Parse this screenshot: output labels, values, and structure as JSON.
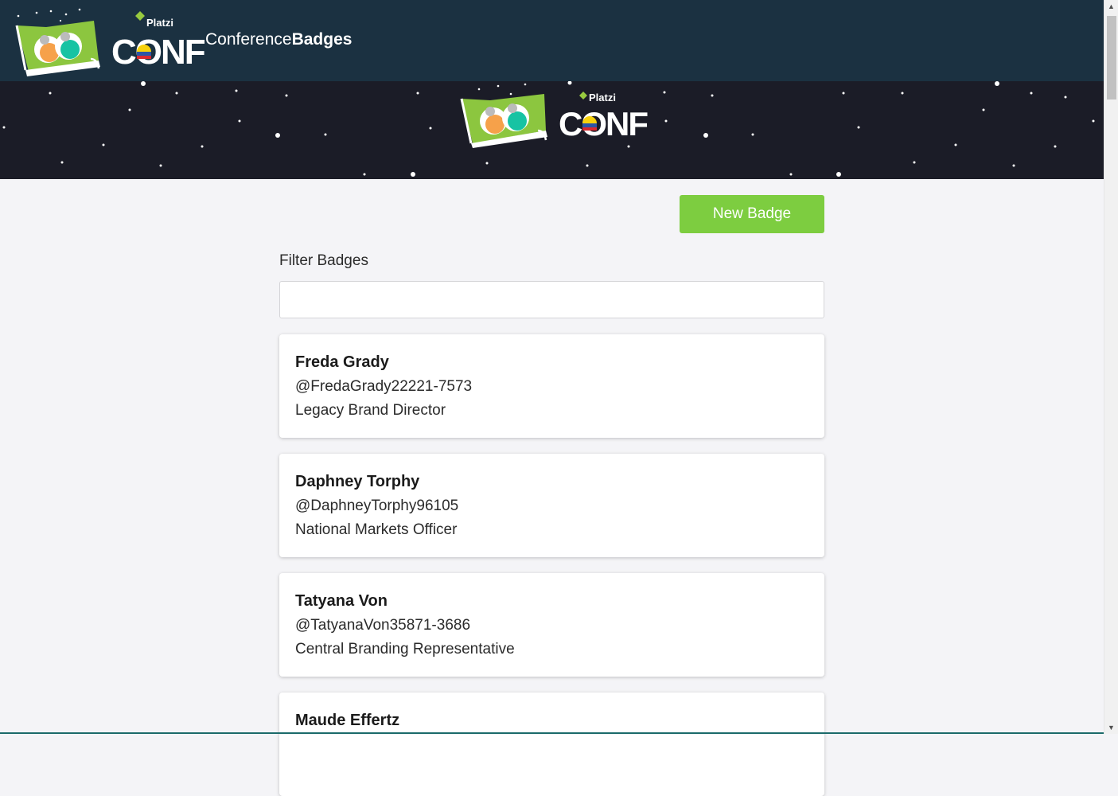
{
  "navbar": {
    "logo_wordmark": "CONF",
    "logo_brand": "Platzi",
    "title_light": "Conference",
    "title_bold": "Badges"
  },
  "hero": {
    "logo_wordmark": "CONF",
    "logo_brand": "Platzi"
  },
  "actions": {
    "new_badge_label": "New Badge"
  },
  "filter": {
    "label": "Filter Badges",
    "value": "",
    "placeholder": ""
  },
  "badges": [
    {
      "name": "Freda Grady",
      "handle": "@FredaGrady22221-7573",
      "job": "Legacy Brand Director"
    },
    {
      "name": "Daphney Torphy",
      "handle": "@DaphneyTorphy96105",
      "job": "National Markets Officer"
    },
    {
      "name": "Tatyana Von",
      "handle": "@TatyanaVon35871-3686",
      "job": "Central Branding Representative"
    },
    {
      "name": "Maude Effertz",
      "handle": "",
      "job": ""
    }
  ],
  "colors": {
    "navbar_bg": "#1b3141",
    "hero_bg": "#1b1c27",
    "accent_green": "#7dcd40",
    "page_bg": "#f4f4f7"
  },
  "icons": {
    "scroll_up": "triangle-up-icon",
    "scroll_down": "triangle-down-icon"
  }
}
